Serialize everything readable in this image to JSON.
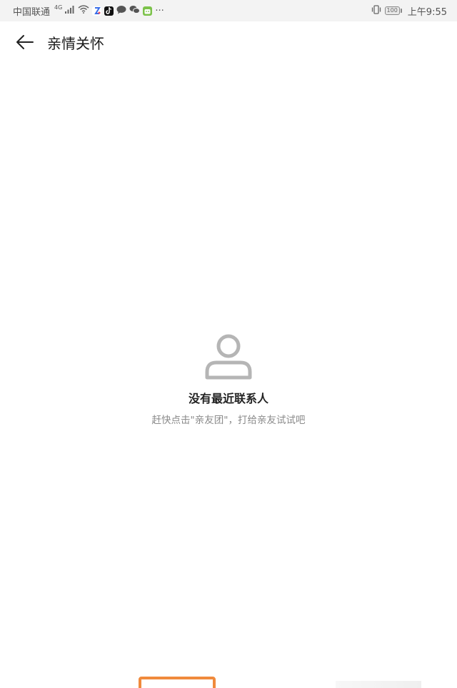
{
  "status_bar": {
    "carrier": "中国联通",
    "network_type": "4G",
    "more_indicator": "···",
    "battery_level": "100",
    "time": "上午9:55",
    "icons": [
      "signal-icon",
      "wifi-icon",
      "app-notification-icon",
      "tiktok-icon",
      "message-icon",
      "wechat-icon",
      "app-icon",
      "vibrate-icon",
      "battery-icon"
    ]
  },
  "toolbar": {
    "title": "亲情关怀"
  },
  "empty_state": {
    "icon": "person-icon",
    "title": "没有最近联系人",
    "subtitle": "赶快点击\"亲友团\"，打给亲友试试吧"
  },
  "colors": {
    "accent": "#f08a3c",
    "text_primary": "#222222",
    "text_secondary": "#8a8a8a",
    "icon_gray": "#b5b5b5"
  }
}
